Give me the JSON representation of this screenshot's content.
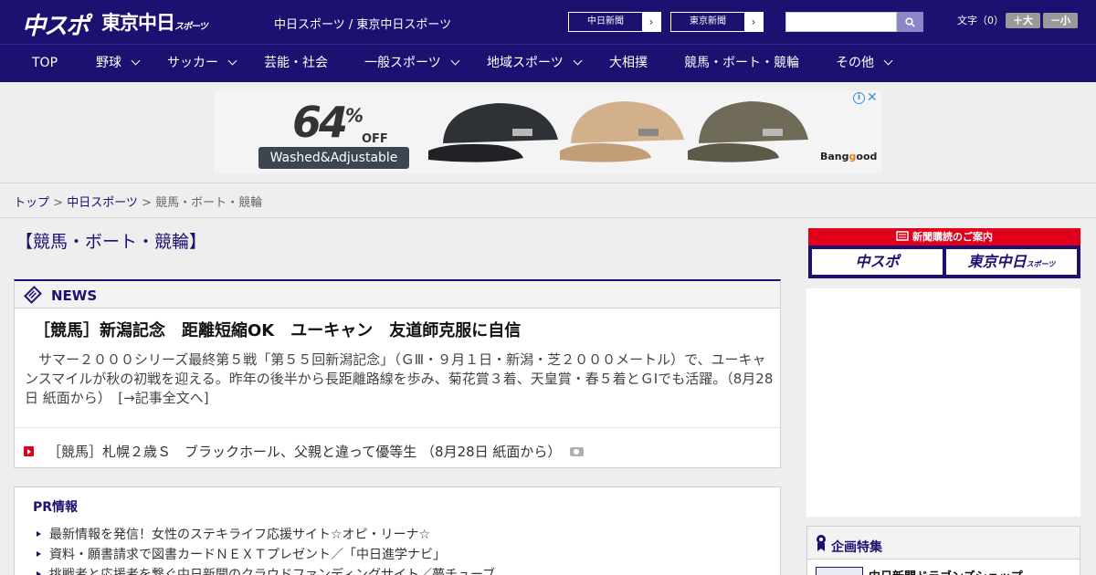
{
  "header": {
    "logo_main": "中スポ",
    "logo_tokyo": "東京中日",
    "logo_tokyo_small": "スポーツ",
    "site_links": "中日スポーツ / 東京中日スポーツ",
    "newspaper_buttons": [
      "中日新聞",
      "東京新聞"
    ],
    "search": {
      "value": "",
      "placeholder": ""
    },
    "font_size_label": "文字（0）",
    "font_larger": "＋大",
    "font_smaller": "－小"
  },
  "nav": {
    "items": [
      {
        "label": "TOP",
        "dropdown": false
      },
      {
        "label": "野球",
        "dropdown": true
      },
      {
        "label": "サッカー",
        "dropdown": true
      },
      {
        "label": "芸能・社会",
        "dropdown": false
      },
      {
        "label": "一般スポーツ",
        "dropdown": true
      },
      {
        "label": "地域スポーツ",
        "dropdown": true
      },
      {
        "label": "大相撲",
        "dropdown": false
      },
      {
        "label": "競馬・ボート・競輪",
        "dropdown": false
      },
      {
        "label": "その他",
        "dropdown": true
      }
    ]
  },
  "ad": {
    "percent": "64",
    "percent_sign": "%",
    "off": "OFF",
    "tagline": "Washed&Adjustable",
    "brand_prefix": "Bang",
    "brand_o": "g",
    "brand_suffix": "ood",
    "info": "i",
    "close": "✕"
  },
  "breadcrumb": {
    "items": [
      "トップ",
      "中日スポーツ"
    ],
    "separator": " > ",
    "current": "競馬・ボート・競輪"
  },
  "main": {
    "page_title": "【競馬・ボート・競輪】",
    "news": {
      "section_title": "NEWS",
      "headline": "［競馬］新潟記念　距離短縮OK　ユーキャン　友道師克服に自信",
      "summary": "　サマー２０００シリーズ最終第５戦「第５５回新潟記念」（ＧⅢ・９月１日・新潟・芝２０００メートル）で、ユーキャンスマイルが秋の初戦を迎える。昨年の後半から長距離路線を歩み、菊花賞３着、天皇賞・春５着とＧⅠでも活躍。（8月28日 紙面から）　[→記事全文へ]",
      "sub_item": "［競馬］札幌２歳Ｓ　ブラックホール、父親と違って優等生 （8月28日 紙面から）"
    },
    "pr": {
      "title": "PR情報",
      "items": [
        "最新情報を発信！女性のステキライフ応援サイト☆オピ・リーナ☆",
        "資料・願書請求で図書カードＮＥＸＴプレゼント／「中日進学ナビ」",
        "挑戦者と応援者を繋ぐ中日新聞のクラウドファンディングサイト／夢チューブ"
      ]
    }
  },
  "sidebar": {
    "subscribe_title": "新聞購読のご案内",
    "subscribe_logos": [
      "中スポ",
      "東京中日"
    ],
    "subscribe_logo_small": "スポーツ",
    "feature_title": "企画特集",
    "feature_item": "中日新聞ドラゴンズショップ"
  },
  "colors": {
    "brand_navy": "#1c1070",
    "accent_red": "#e0001b"
  }
}
